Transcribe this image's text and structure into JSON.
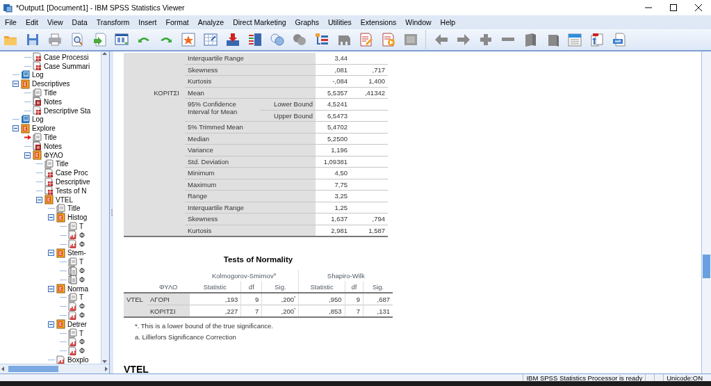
{
  "window": {
    "title": "*Output1 [Document1] - IBM SPSS Statistics Viewer"
  },
  "menu": [
    "File",
    "Edit",
    "View",
    "Data",
    "Transform",
    "Insert",
    "Format",
    "Analyze",
    "Direct Marketing",
    "Graphs",
    "Utilities",
    "Extensions",
    "Window",
    "Help"
  ],
  "outline": [
    {
      "children": [
        {
          "label": "Case Processi",
          "kind": "table",
          "current": false
        },
        {
          "label": "Case Summari",
          "kind": "table",
          "current": false
        }
      ]
    },
    {
      "label": "Log",
      "kind": "log",
      "current": false
    },
    {
      "label": "Descriptives",
      "kind": "procedure",
      "expanded": true,
      "current": false,
      "children": [
        {
          "label": "Title",
          "kind": "title",
          "current": false
        },
        {
          "label": "Notes",
          "kind": "notes",
          "current": false
        },
        {
          "label": "Descriptive Sta",
          "kind": "table",
          "current": false
        }
      ]
    },
    {
      "label": "Log",
      "kind": "log",
      "current": false
    },
    {
      "label": "Explore",
      "kind": "procedure",
      "expanded": true,
      "current": false,
      "children": [
        {
          "label": "Title",
          "kind": "title",
          "current": true
        },
        {
          "label": "Notes",
          "kind": "notes",
          "current": false
        },
        {
          "label": "ΦΥΛΟ",
          "kind": "procedure",
          "expanded": true,
          "current": false,
          "children": [
            {
              "label": "Title",
              "kind": "title",
              "current": false
            },
            {
              "label": "Case Proc",
              "kind": "table",
              "current": false
            },
            {
              "label": "Descriptive",
              "kind": "table",
              "current": false
            },
            {
              "label": "Tests of N",
              "kind": "table",
              "current": false
            },
            {
              "label": "VTEL",
              "kind": "procedure",
              "expanded": true,
              "current": false,
              "children": [
                {
                  "label": "Title",
                  "kind": "title",
                  "current": false
                },
                {
                  "label": "Histog",
                  "kind": "procedure",
                  "expanded": true,
                  "current": false,
                  "children": [
                    {
                      "label": "T",
                      "kind": "title",
                      "current": false
                    },
                    {
                      "label": "Φ",
                      "kind": "chart",
                      "current": false
                    },
                    {
                      "label": "Φ",
                      "kind": "chart",
                      "current": false
                    }
                  ]
                },
                {
                  "label": "Stem-",
                  "kind": "procedure",
                  "expanded": true,
                  "current": false,
                  "children": [
                    {
                      "label": "T",
                      "kind": "title",
                      "current": false
                    },
                    {
                      "label": "Φ",
                      "kind": "text",
                      "current": false
                    },
                    {
                      "label": "Φ",
                      "kind": "text",
                      "current": false
                    }
                  ]
                },
                {
                  "label": "Norma",
                  "kind": "procedure",
                  "expanded": true,
                  "current": false,
                  "children": [
                    {
                      "label": "T",
                      "kind": "title",
                      "current": false
                    },
                    {
                      "label": "Φ",
                      "kind": "chart",
                      "current": false
                    },
                    {
                      "label": "Φ",
                      "kind": "chart",
                      "current": false
                    }
                  ]
                },
                {
                  "label": "Detrer",
                  "kind": "procedure",
                  "expanded": true,
                  "current": false,
                  "children": [
                    {
                      "label": "T",
                      "kind": "title",
                      "current": false
                    },
                    {
                      "label": "Φ",
                      "kind": "chart",
                      "current": false
                    },
                    {
                      "label": "Φ",
                      "kind": "chart",
                      "current": false
                    }
                  ]
                },
                {
                  "label": "Boxplo",
                  "kind": "chart",
                  "current": false
                }
              ]
            }
          ]
        }
      ]
    }
  ],
  "descriptives_table": {
    "rows": [
      {
        "label": "Interquartile Range",
        "statistic": "3,44"
      },
      {
        "label": "Skewness",
        "statistic": ",081",
        "std_error": ",717"
      },
      {
        "label": "Kurtosis",
        "statistic": "-,084",
        "std_error": "1,400"
      },
      {
        "group": "ΚΟΡΙΤΣΙ",
        "label": "Mean",
        "statistic": "5,5357",
        "std_error": ",41342"
      },
      {
        "label": "95% Confidence Interval for Mean",
        "bounds": [
          {
            "label": "Lower Bound",
            "statistic": "4,5241"
          },
          {
            "label": "Upper Bound",
            "statistic": "6,5473"
          }
        ]
      },
      {
        "label": "5% Trimmed Mean",
        "statistic": "5,4702"
      },
      {
        "label": "Median",
        "statistic": "5,2500"
      },
      {
        "label": "Variance",
        "statistic": "1,196"
      },
      {
        "label": "Std. Deviation",
        "statistic": "1,09381"
      },
      {
        "label": "Minimum",
        "statistic": "4,50"
      },
      {
        "label": "Maximum",
        "statistic": "7,75"
      },
      {
        "label": "Range",
        "statistic": "3,25"
      },
      {
        "label": "Interquartile Range",
        "statistic": "1,25"
      },
      {
        "label": "Skewness",
        "statistic": "1,637",
        "std_error": ",794"
      },
      {
        "label": "Kurtosis",
        "statistic": "2,981",
        "std_error": "1,587"
      }
    ]
  },
  "normality_table": {
    "title": "Tests of Normality",
    "groups": [
      "Kolmogorov-Smirnov$^{a}$",
      "Shapiro-Wilk"
    ],
    "factor": "ΦΥΛΟ",
    "columns": [
      "Statistic",
      "df",
      "Sig.",
      "Statistic",
      "df",
      "Sig."
    ],
    "variable": "VTEL",
    "rows": [
      {
        "category": "ΑΓΟΡΙ",
        "values": [
          ",193",
          "9",
          ",200$^{*}$",
          ",950",
          "9",
          ",687"
        ]
      },
      {
        "category": "ΚΟΡΙΤΣΙ",
        "values": [
          ",227",
          "7",
          ",200$^{*}$",
          ",853",
          "7",
          ",131"
        ]
      }
    ],
    "footnotes": [
      "*. This is a lower bound of the true significance.",
      "a. Lilliefors Significance Correction"
    ]
  },
  "heading": "VTEL",
  "status_bar": {
    "message": "IBM SPSS Statistics Processor is ready",
    "encoding": "Unicode:ON"
  }
}
